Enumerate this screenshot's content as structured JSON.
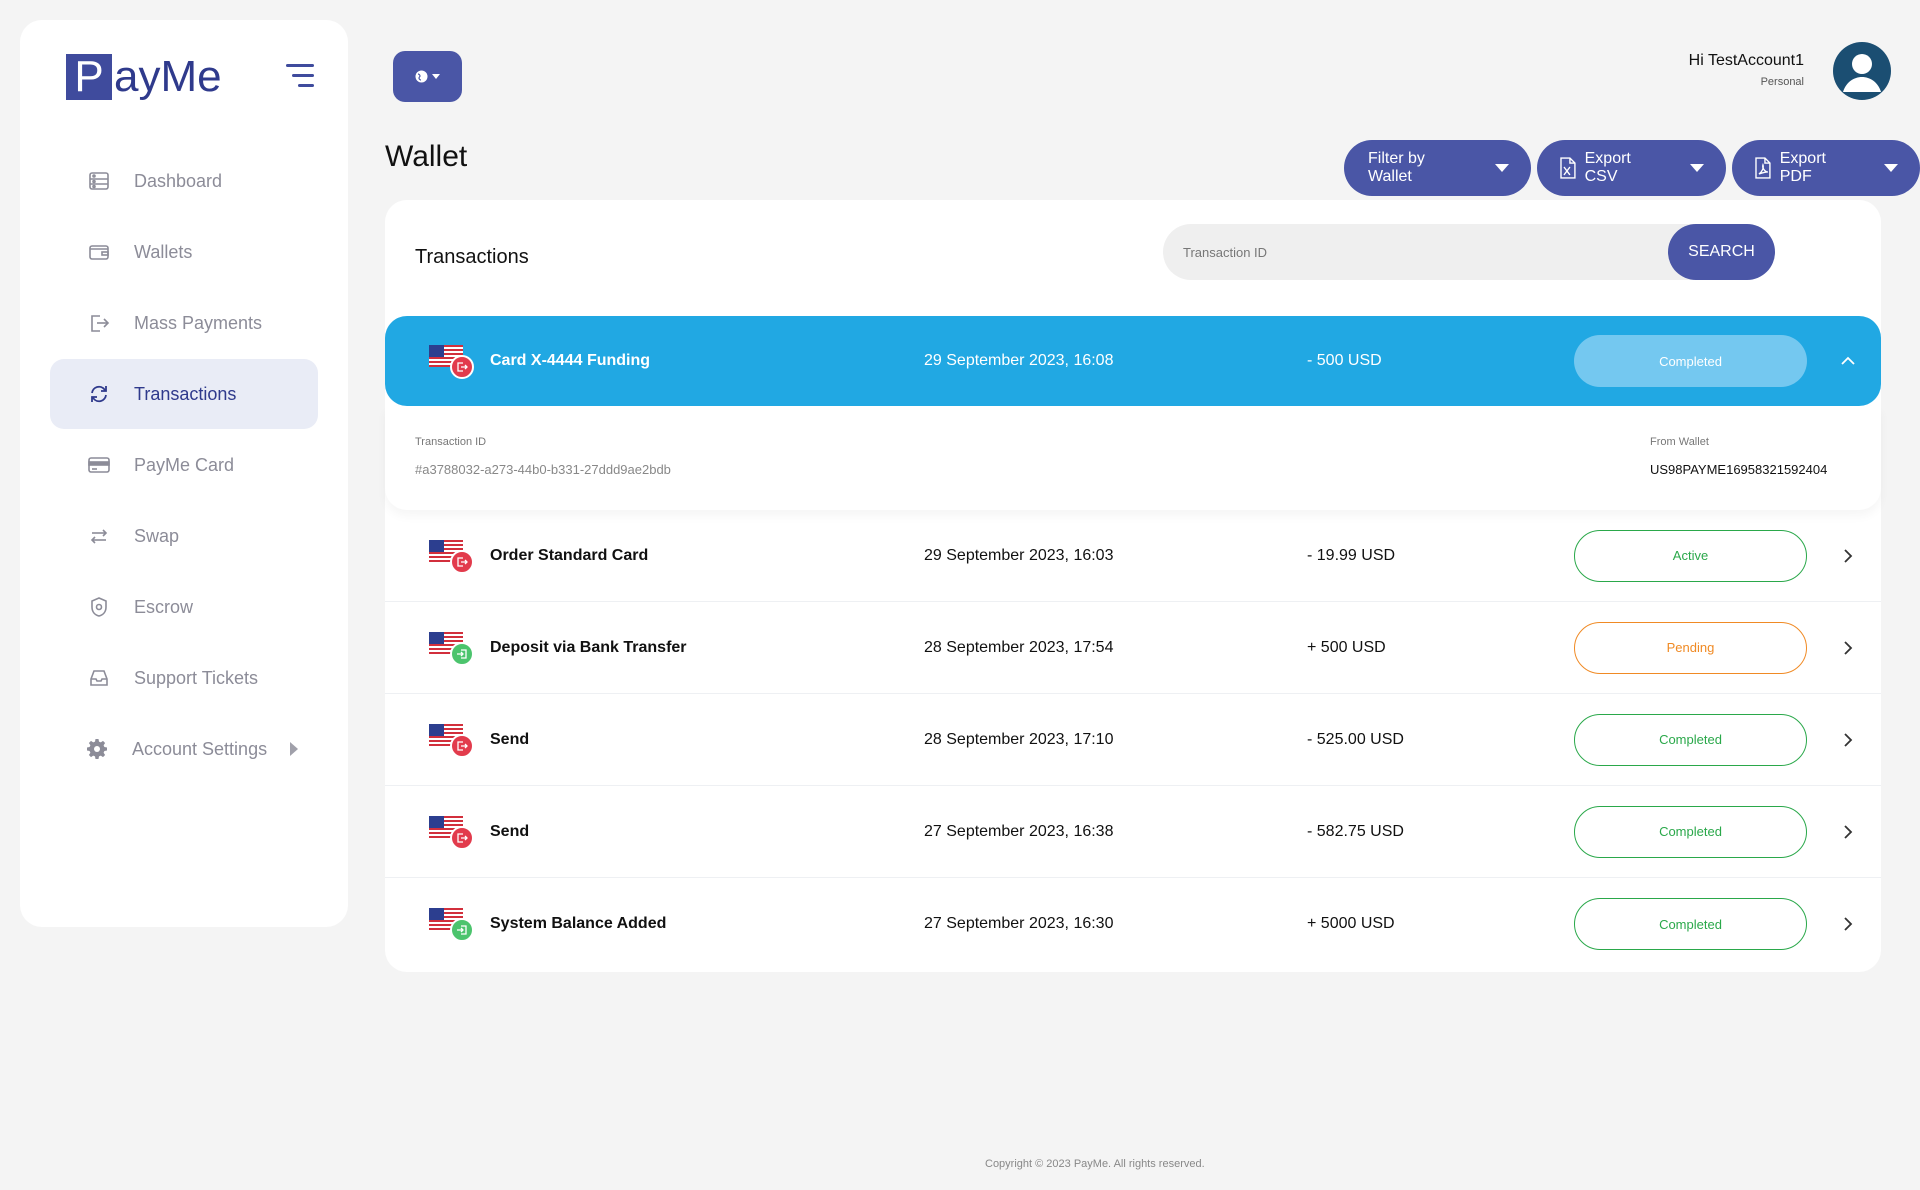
{
  "brand": {
    "logo_letter": "P",
    "logo_rest": "ayMe"
  },
  "sidebar": {
    "items": [
      {
        "label": "Dashboard",
        "icon": "dashboard-icon"
      },
      {
        "label": "Wallets",
        "icon": "wallet-icon"
      },
      {
        "label": "Mass Payments",
        "icon": "mass-payments-icon"
      },
      {
        "label": "Transactions",
        "icon": "refresh-icon",
        "active": true
      },
      {
        "label": "PayMe Card",
        "icon": "card-icon"
      },
      {
        "label": "Swap",
        "icon": "swap-icon"
      },
      {
        "label": "Escrow",
        "icon": "shield-icon"
      },
      {
        "label": "Support Tickets",
        "icon": "inbox-icon"
      },
      {
        "label": "Account Settings",
        "icon": "gear-icon"
      }
    ]
  },
  "header": {
    "greeting": "Hi TestAccount1",
    "account_type": "Personal"
  },
  "page": {
    "title": "Wallet",
    "filter_label": "Filter by Wallet",
    "export_csv_label": "Export CSV",
    "export_pdf_label": "Export PDF"
  },
  "transactions": {
    "title": "Transactions",
    "search_placeholder": "Transaction ID",
    "search_label": "SEARCH",
    "expanded_details": {
      "id_label": "Transaction ID",
      "id_value": "#a3788032-a273-44b0-b331-27ddd9ae2bdb",
      "wallet_label": "From Wallet",
      "wallet_value": "US98PAYME16958321592404"
    },
    "rows": [
      {
        "name": "Card X-4444 Funding",
        "date": "29 September 2023, 16:08",
        "amount": "- 500 USD",
        "status": "Completed",
        "direction": "out"
      },
      {
        "name": "Order Standard Card",
        "date": "29 September 2023, 16:03",
        "amount": "- 19.99 USD",
        "status": "Active",
        "direction": "out"
      },
      {
        "name": "Deposit via Bank Transfer",
        "date": "28 September 2023, 17:54",
        "amount": "+ 500 USD",
        "status": "Pending",
        "direction": "in"
      },
      {
        "name": "Send",
        "date": "28 September 2023, 17:10",
        "amount": "- 525.00 USD",
        "status": "Completed",
        "direction": "out"
      },
      {
        "name": "Send",
        "date": "27 September 2023, 16:38",
        "amount": "- 582.75 USD",
        "status": "Completed",
        "direction": "out"
      },
      {
        "name": "System Balance Added",
        "date": "27 September 2023, 16:30",
        "amount": "+ 5000 USD",
        "status": "Completed",
        "direction": "in"
      }
    ]
  },
  "footer": {
    "copyright": "Copyright © 2023 PayMe. All rights reserved."
  },
  "colors": {
    "primary": "#4a56a6",
    "expanded_row": "#21a8e3",
    "success": "#2aa84a",
    "pending": "#f08a24"
  }
}
